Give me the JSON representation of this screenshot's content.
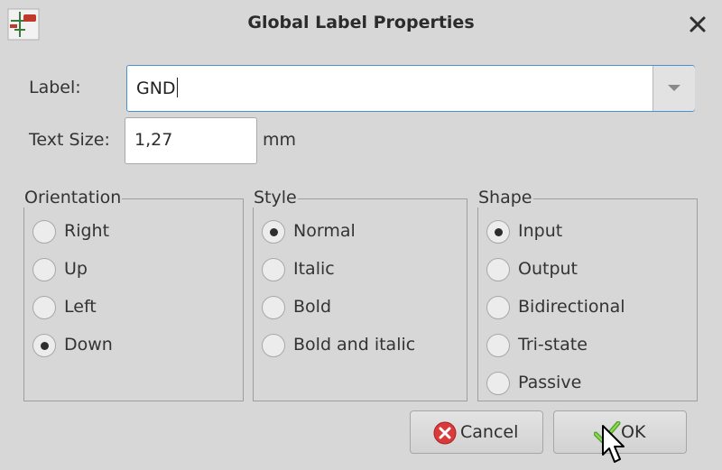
{
  "window": {
    "title": "Global Label Properties"
  },
  "label_field": {
    "label": "Label:",
    "value": "GND"
  },
  "text_size": {
    "label": "Text Size:",
    "value": "1,27",
    "unit": "mm"
  },
  "orientation": {
    "title": "Orientation",
    "options": [
      "Right",
      "Up",
      "Left",
      "Down"
    ],
    "selected": "Down"
  },
  "style": {
    "title": "Style",
    "options": [
      "Normal",
      "Italic",
      "Bold",
      "Bold and italic"
    ],
    "selected": "Normal"
  },
  "shape": {
    "title": "Shape",
    "options": [
      "Input",
      "Output",
      "Bidirectional",
      "Tri-state",
      "Passive"
    ],
    "selected": "Input"
  },
  "buttons": {
    "cancel": "Cancel",
    "ok": "OK"
  },
  "colors": {
    "background": "#d7d7d7",
    "focus_border": "#4a90d9",
    "cancel_icon": "#d93a3a",
    "ok_icon": "#6cbf3a"
  },
  "icons": {
    "app": "eeschema-label-icon",
    "close": "close-icon",
    "dropdown": "chevron-down-icon",
    "cancel": "cancel-icon",
    "ok": "checkmark-icon"
  }
}
